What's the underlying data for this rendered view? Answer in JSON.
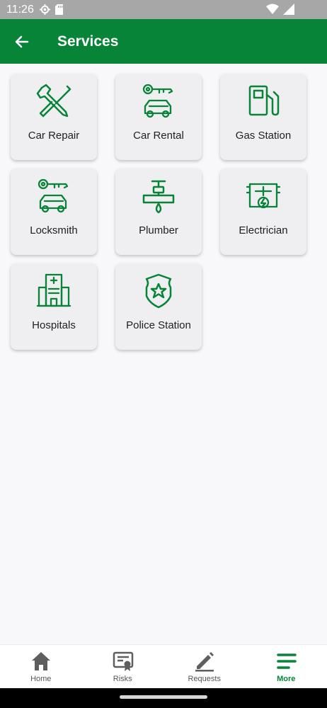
{
  "status_bar": {
    "time": "11:26"
  },
  "header": {
    "title": "Services"
  },
  "services": [
    {
      "label": "Car Repair",
      "icon": "wrench-screwdriver-icon"
    },
    {
      "label": "Car Rental",
      "icon": "car-key-icon"
    },
    {
      "label": "Gas Station",
      "icon": "fuel-pump-icon"
    },
    {
      "label": "Locksmith",
      "icon": "key-car-icon"
    },
    {
      "label": "Plumber",
      "icon": "faucet-icon"
    },
    {
      "label": "Electrician",
      "icon": "electric-panel-icon"
    },
    {
      "label": "Hospitals",
      "icon": "hospital-icon"
    },
    {
      "label": "Police Station",
      "icon": "police-badge-icon"
    }
  ],
  "bottom_nav": [
    {
      "label": "Home",
      "icon": "home-icon",
      "active": false
    },
    {
      "label": "Risks",
      "icon": "certificate-icon",
      "active": false
    },
    {
      "label": "Requests",
      "icon": "pencil-icon",
      "active": false
    },
    {
      "label": "More",
      "icon": "menu-lines-icon",
      "active": true
    }
  ],
  "colors": {
    "primary": "#078437",
    "status_bar": "#a7a7a7",
    "tile_bg": "#efeef1",
    "page_bg": "#f8f7fa"
  }
}
